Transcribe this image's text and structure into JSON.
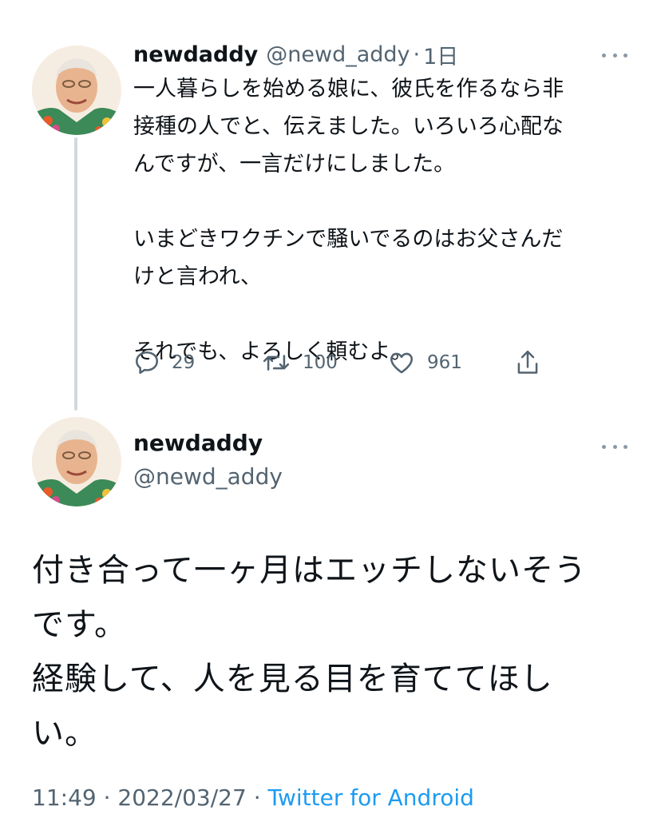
{
  "reply": {
    "name": "newdaddy",
    "handle": "@newd_addy",
    "separator": "·",
    "time": "1日",
    "lines": [
      "一人暮らしを始める娘に、彼氏を作るなら非",
      "接種の人でと、伝えました。いろいろ心配な",
      "んですが、一言だけにしました。",
      "",
      "いまどきワクチンで騒いでるのはお父さんだ",
      "けと言われ、",
      "",
      "それでも、よろしく頼むよ。"
    ],
    "replies": "29",
    "retweets": "100",
    "likes": "961"
  },
  "main": {
    "name": "newdaddy",
    "handle": "@newd_addy",
    "lines": [
      "付き合って一ヶ月はエッチしないそう",
      "です。",
      "経験して、人を見る目を育ててほし",
      "い。"
    ],
    "time": "11:49",
    "separator1": " · ",
    "date": "2022/03/27",
    "separator2": " · ",
    "source": "Twitter for Android"
  },
  "colors": {
    "text": "#0f1419",
    "secondary": "#536471",
    "link": "#1d9bf0",
    "thread_line": "#cfd9de"
  },
  "icons": {
    "reply": "comment-bubble-icon",
    "retweet": "retweet-icon",
    "like": "heart-icon",
    "share": "share-icon",
    "more": "more-dots-icon"
  }
}
